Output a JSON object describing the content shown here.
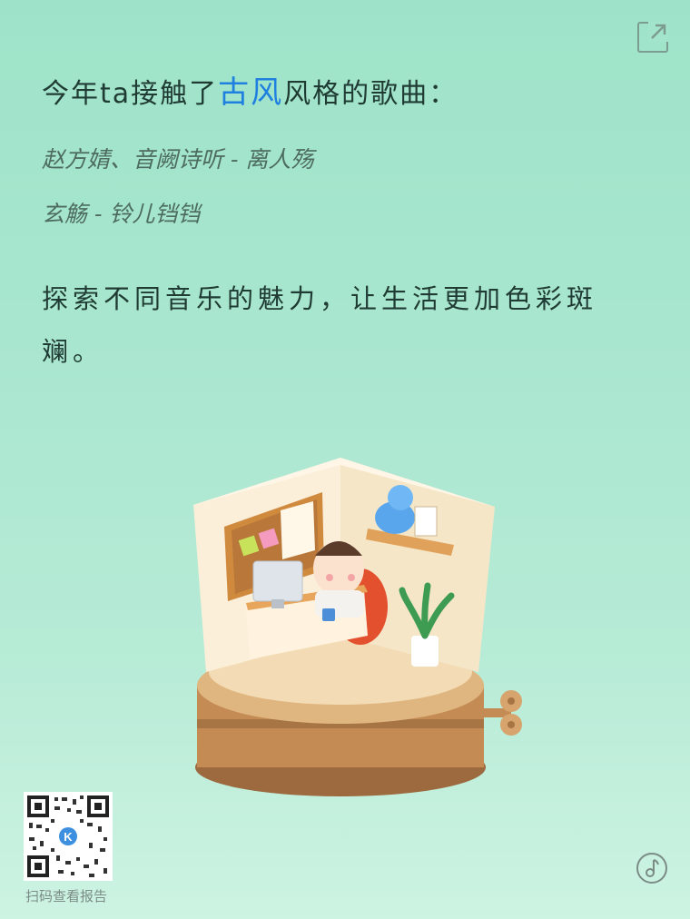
{
  "headline": {
    "before": "今年ta接触了",
    "keyword": "古风",
    "after": "风格的歌曲："
  },
  "songs": [
    "赵方婧、音阙诗听 - 离人殇",
    "玄觞 - 铃儿铛铛"
  ],
  "slogan": "探索不同音乐的魅力，让生活更加色彩斑斓。",
  "qr_caption": "扫码查看报告",
  "icons": {
    "share": "share-icon",
    "music": "music-note-icon"
  },
  "colors": {
    "keyword": "#1f80df",
    "text": "#1f3b33",
    "song": "#4d6b61"
  }
}
